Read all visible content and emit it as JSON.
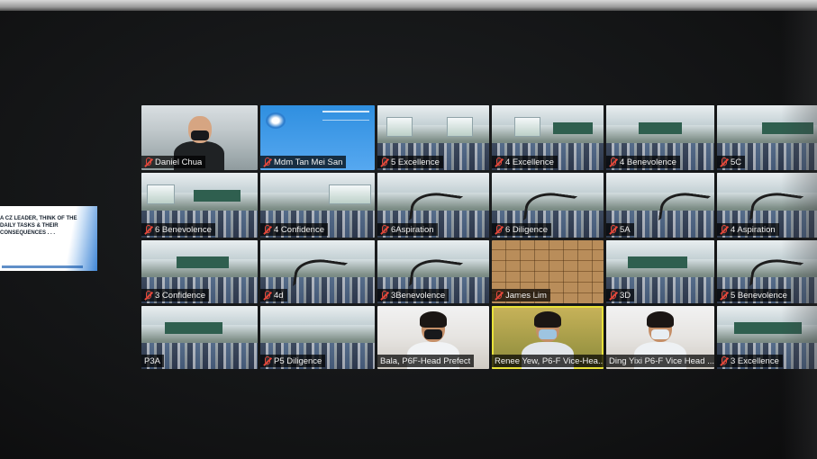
{
  "shared_content": {
    "text": "A CZ LEADER, THINK OF THE DAILY TASKS & THEIR CONSEQUENCES . . ."
  },
  "participants": [
    {
      "name": "Daniel Chua",
      "muted": true
    },
    {
      "name": "Mdm Tan Mei San",
      "muted": true
    },
    {
      "name": "5 Excellence",
      "muted": true
    },
    {
      "name": "4 Excellence",
      "muted": true
    },
    {
      "name": "4 Benevolence",
      "muted": true
    },
    {
      "name": "5C",
      "muted": true
    },
    {
      "name": "6 Benevolence",
      "muted": true
    },
    {
      "name": "4 Confidence",
      "muted": true
    },
    {
      "name": "6Aspiration",
      "muted": true
    },
    {
      "name": "6 Diligence",
      "muted": true
    },
    {
      "name": "5A",
      "muted": true
    },
    {
      "name": "4 Aspiration",
      "muted": true
    },
    {
      "name": "3 Confidence",
      "muted": true
    },
    {
      "name": "4d",
      "muted": true
    },
    {
      "name": "3Benevolence",
      "muted": true
    },
    {
      "name": "James Lim",
      "muted": true
    },
    {
      "name": "3D",
      "muted": true
    },
    {
      "name": "5 Benevolence",
      "muted": true
    },
    {
      "name": "P3A",
      "muted": true
    },
    {
      "name": "P5 Diligence",
      "muted": true
    },
    {
      "name": "Bala, P6F-Head Prefect",
      "muted": false
    },
    {
      "name": "Renee Yew, P6-F Vice-Hea...",
      "muted": false,
      "active_speaker": true
    },
    {
      "name": "Ding Yixi P6-F Vice Head ...",
      "muted": false
    },
    {
      "name": "3 Excellence",
      "muted": true
    }
  ],
  "icons": {
    "muted": "mic-muted-icon"
  },
  "colors": {
    "active_speaker_border": "#e8e23a",
    "muted_icon": "#e5483b",
    "name_bg": "rgba(0,0,0,0.72)"
  }
}
